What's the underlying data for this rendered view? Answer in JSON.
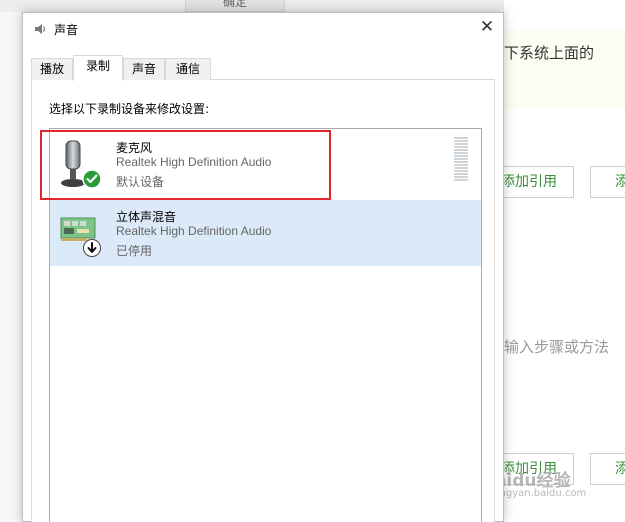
{
  "background": {
    "top_tab_label": "确定",
    "snippet_1": "下系统上面的",
    "button_1": "添加引用",
    "button_2": "添加",
    "snippet_2": "输入步骤或方法",
    "button_3": "添加引用",
    "button_4": "添加",
    "watermark": "Baidu经验",
    "watermark_url": "jingyan.baidu.com"
  },
  "dialog": {
    "title": "声音",
    "close_icon": "close-icon",
    "tabs": [
      {
        "label": "播放",
        "active": false
      },
      {
        "label": "录制",
        "active": true
      },
      {
        "label": "声音",
        "active": false
      },
      {
        "label": "通信",
        "active": false
      }
    ],
    "instruction": "选择以下录制设备来修改设置:",
    "devices": [
      {
        "name": "麦克风",
        "description": "Realtek High Definition Audio",
        "status": "默认设备",
        "icon": "microphone-icon",
        "badge": "default-check-icon",
        "selected": false,
        "highlighted": true
      },
      {
        "name": "立体声混音",
        "description": "Realtek High Definition Audio",
        "status": "已停用",
        "icon": "sound-card-icon",
        "badge": "disabled-arrow-icon",
        "selected": true,
        "highlighted": false
      }
    ]
  },
  "colors": {
    "highlight_box": "#e0282a",
    "selected_row": "#dbe9f8",
    "default_badge": "#2a9a3a",
    "background_button_text": "#3b8f3b"
  }
}
